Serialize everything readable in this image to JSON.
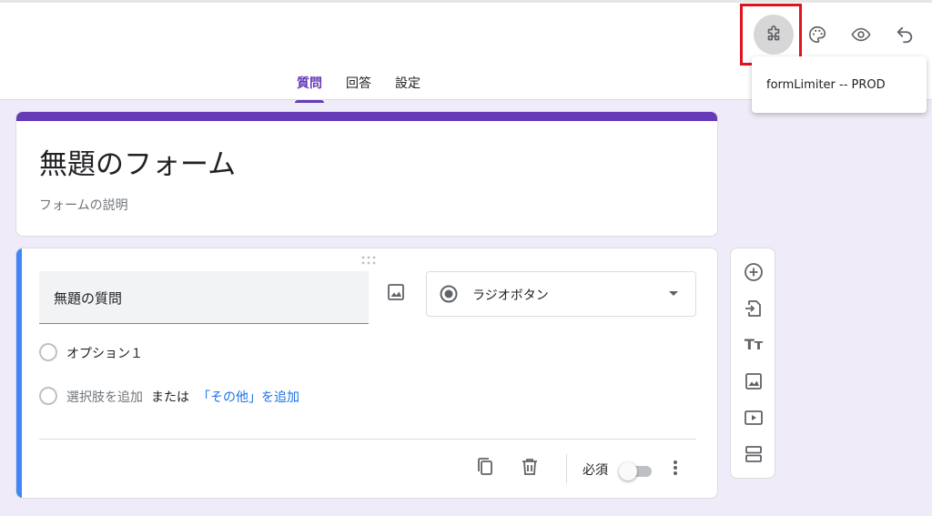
{
  "header": {
    "tabs": [
      {
        "label": "質問",
        "active": true
      },
      {
        "label": "回答",
        "active": false
      },
      {
        "label": "設定",
        "active": false
      }
    ],
    "actions": [
      {
        "icon": "puzzle-icon",
        "label": "Add-ons"
      },
      {
        "icon": "palette-icon",
        "label": "Customize theme"
      },
      {
        "icon": "eye-icon",
        "label": "Preview"
      },
      {
        "icon": "undo-icon",
        "label": "Undo"
      }
    ],
    "addon_menu": {
      "items": [
        "formLimiter -- PROD"
      ]
    }
  },
  "form": {
    "title": "無題のフォーム",
    "description": "フォームの説明"
  },
  "question": {
    "title": "無題の質問",
    "type": "ラジオボタン",
    "options": [
      "オプション１"
    ],
    "add_option": "選択肢を追加",
    "or_text": "または",
    "add_other": "「その他」を追加",
    "required_label": "必須",
    "required": false
  },
  "toolbar": {
    "items": [
      "add-question-icon",
      "import-questions-icon",
      "add-title-icon",
      "add-image-icon",
      "add-video-icon",
      "add-section-icon"
    ],
    "title_glyph": "Tт"
  },
  "colors": {
    "accent": "#673ab7",
    "background": "#f0ebf8",
    "link": "#1a73e8",
    "question_bar": "#4285f4",
    "highlight": "#e0141e"
  }
}
